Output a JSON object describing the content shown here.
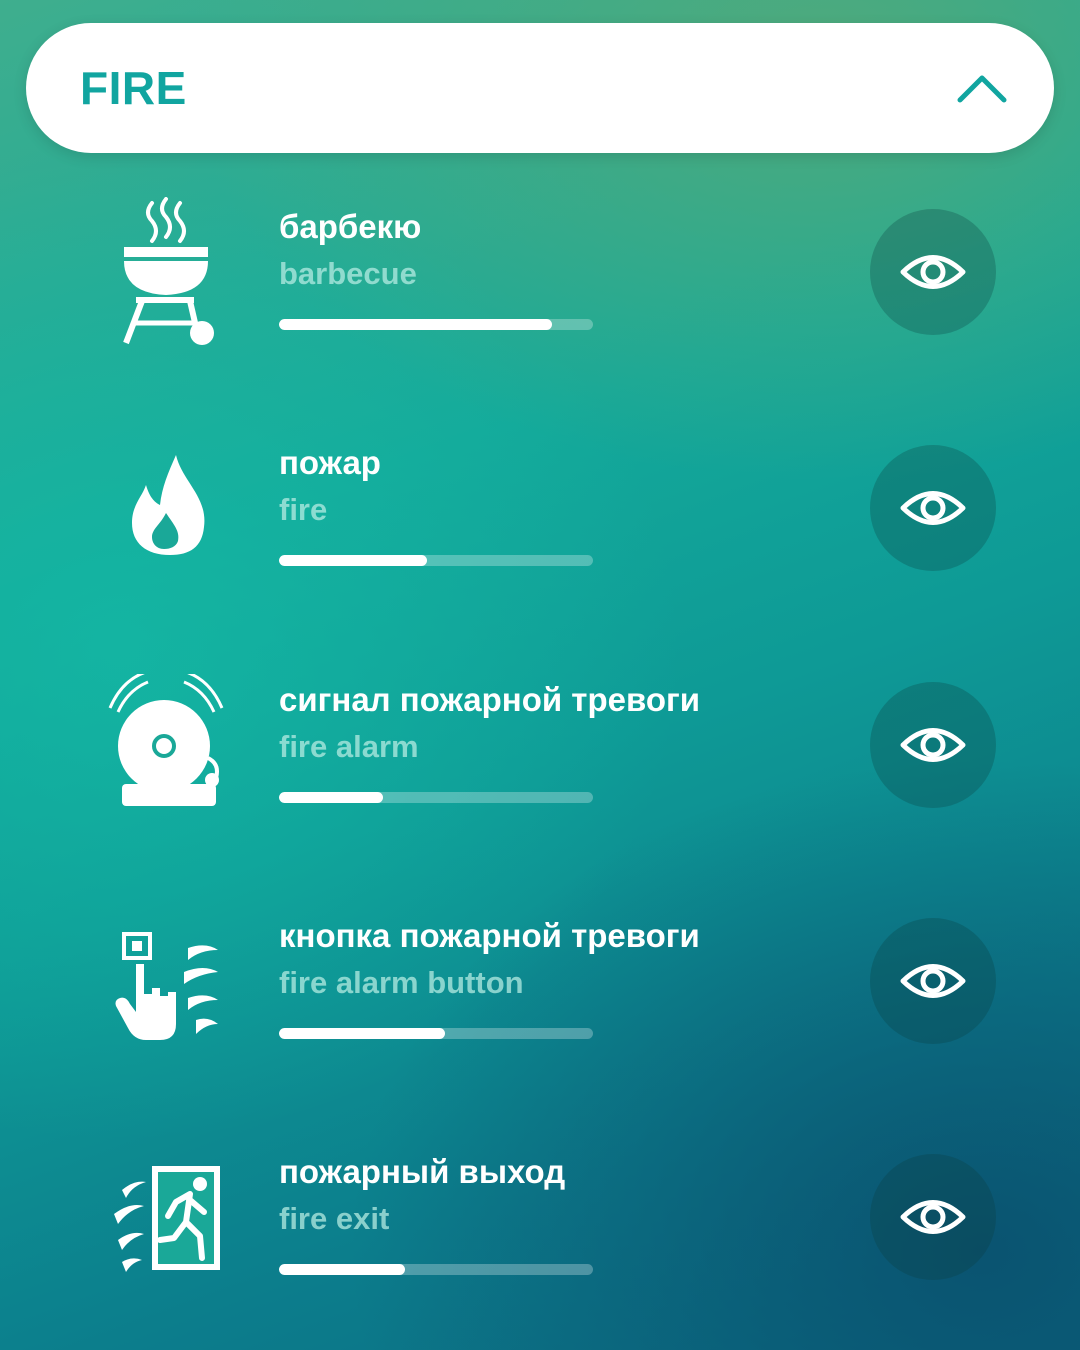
{
  "header": {
    "title": "FIRE"
  },
  "colors": {
    "accent": "#11a5a0",
    "text_primary": "#ffffff"
  },
  "items": [
    {
      "ru": "барбекю",
      "en": "barbecue",
      "icon": "barbecue-grill-icon",
      "progress": 0.87
    },
    {
      "ru": "пожар",
      "en": "fire",
      "icon": "flame-icon",
      "progress": 0.47
    },
    {
      "ru": "сигнал пожарной тревоги",
      "en": "fire alarm",
      "icon": "fire-alarm-bell-icon",
      "progress": 0.33
    },
    {
      "ru": "кнопка пожарной тревоги",
      "en": "fire alarm button",
      "icon": "fire-alarm-button-icon",
      "progress": 0.53
    },
    {
      "ru": "пожарный выход",
      "en": "fire exit",
      "icon": "fire-exit-icon",
      "progress": 0.4
    }
  ]
}
